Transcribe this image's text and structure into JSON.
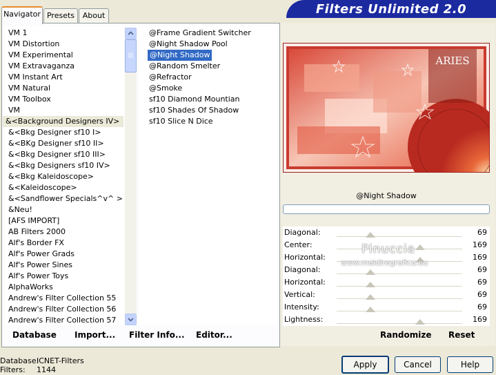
{
  "window": {
    "title": "Filters Unlimited 2.0"
  },
  "tabs": [
    {
      "label": "Navigator"
    },
    {
      "label": "Presets"
    },
    {
      "label": "About"
    }
  ],
  "categories": [
    "VM 1",
    "VM Distortion",
    "VM Experimental",
    "VM Extravaganza",
    "VM Instant Art",
    "VM Natural",
    "VM Toolbox",
    "VM",
    "&<Background Designers IV>",
    "&<Bkg Designer sf10 I>",
    "&<BKg Designer sf10 II>",
    "&<Bkg Designer sf10 III>",
    "&<Bkg Designers sf10 IV>",
    "&<Bkg Kaleidoscope>",
    "&<Kaleidoscope>",
    "&<Sandflower Specials^v^ >",
    "&Neu!",
    "[AFS IMPORT]",
    "AB Filters 2000",
    "Alf's Border FX",
    "Alf's Power Grads",
    "Alf's Power Sines",
    "Alf's Power Toys",
    "AlphaWorks",
    "Andrew's Filter Collection 55",
    "Andrew's Filter Collection 56",
    "Andrew's Filter Collection 57"
  ],
  "selected_category": "&<Background Designers IV>",
  "filters": [
    "@Frame Gradient Switcher",
    "@Night Shadow Pool",
    "@Night Shadow",
    "@Random Smelter",
    "@Refractor",
    "@Smoke",
    "sf10 Diamond Mountian",
    "sf10 Shades Of Shadow",
    "sf10 Slice N Dice"
  ],
  "selected_filter": "@Night Shadow",
  "preview": {
    "filter_name": "@Night Shadow",
    "aries_title": "ARIES",
    "watermark_name": "Pinuccia",
    "watermark_url": "www.maidiregrafica.eu"
  },
  "params": [
    {
      "label": "Diagonal:",
      "value": "69",
      "level": 0.271
    },
    {
      "label": "Center:",
      "value": "169",
      "level": 0.663
    },
    {
      "label": "Horizontal:",
      "value": "169",
      "level": 0.663
    },
    {
      "label": "Diagonal:",
      "value": "69",
      "level": 0.271
    },
    {
      "label": "Horizontal:",
      "value": "69",
      "level": 0.271
    },
    {
      "label": "Vertical:",
      "value": "69",
      "level": 0.271
    },
    {
      "label": "Intensity:",
      "value": "69",
      "level": 0.271
    },
    {
      "label": "Lightness:",
      "value": "169",
      "level": 0.663
    }
  ],
  "bottom_links": {
    "database": "Database",
    "import": "Import...",
    "filter_info": "Filter Info...",
    "editor": "Editor...",
    "randomize": "Randomize",
    "reset": "Reset"
  },
  "status": {
    "database_label": "Database:",
    "database_value": "ICNET-Filters",
    "filters_label": "Filters:",
    "filters_value": "1144"
  },
  "buttons": {
    "apply": "Apply",
    "cancel": "Cancel",
    "help": "Help"
  },
  "colors": {
    "selection": "#316ac5",
    "banner": "#1c2aa0",
    "frame": "#9c2020"
  }
}
